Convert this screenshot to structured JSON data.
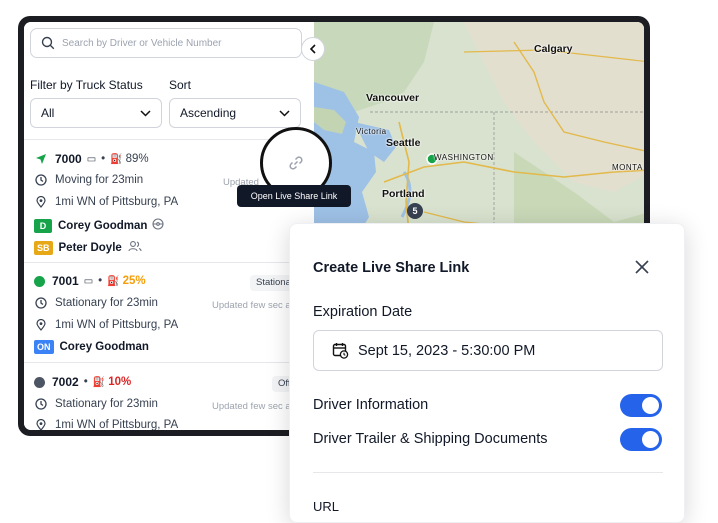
{
  "search": {
    "placeholder": "Search by Driver or Vehicle Number"
  },
  "filters": {
    "status_label": "Filter by Truck Status",
    "status_value": "All",
    "sort_label": "Sort",
    "sort_value": "Ascending"
  },
  "vehicles": [
    {
      "number": "7000",
      "battery": "89%",
      "status_text": "Moving for 23min",
      "updated": "Updated",
      "location": "1mi WN of Pittsburg, PA",
      "drivers": [
        {
          "badge": "D",
          "badge_color": "#16a34a",
          "name": "Corey Goodman"
        },
        {
          "badge": "SB",
          "badge_color": "#e6a817",
          "name": "Peter Doyle"
        }
      ]
    },
    {
      "number": "7001",
      "battery": "25%",
      "status_badge": "Stationar",
      "status_text": "Stationary for 23min",
      "updated": "Updated few sec a",
      "location": "1mi WN of Pittsburg, PA",
      "drivers": [
        {
          "badge": "ON",
          "badge_color": "#3b82f6",
          "name": "Corey Goodman"
        }
      ]
    },
    {
      "number": "7002",
      "battery": "10%",
      "status_badge": "Offlin",
      "status_text": "Stationary for 23min",
      "updated": "Updated few sec ago",
      "location": "1mi WN of Pittsburg, PA"
    }
  ],
  "map": {
    "cities": [
      "Calgary",
      "Vancouver",
      "Victoria",
      "Seattle",
      "WASHINGTON",
      "Portland",
      "MONTA"
    ],
    "cluster_count": "5"
  },
  "tooltip": "Open Live Share Link",
  "modal": {
    "title": "Create Live Share Link",
    "expiration_label": "Expiration Date",
    "expiration_value": "Sept 15, 2023 - 5:30:00 PM",
    "driver_info_label": "Driver Information",
    "driver_info_on": true,
    "docs_label": "Driver Trailer & Shipping Documents",
    "docs_on": true,
    "url_label": "URL"
  },
  "colors": {
    "accent": "#2563eb",
    "moving": "#16a34a",
    "low_battery": "#f59e0b",
    "critical_battery": "#dc2626"
  }
}
